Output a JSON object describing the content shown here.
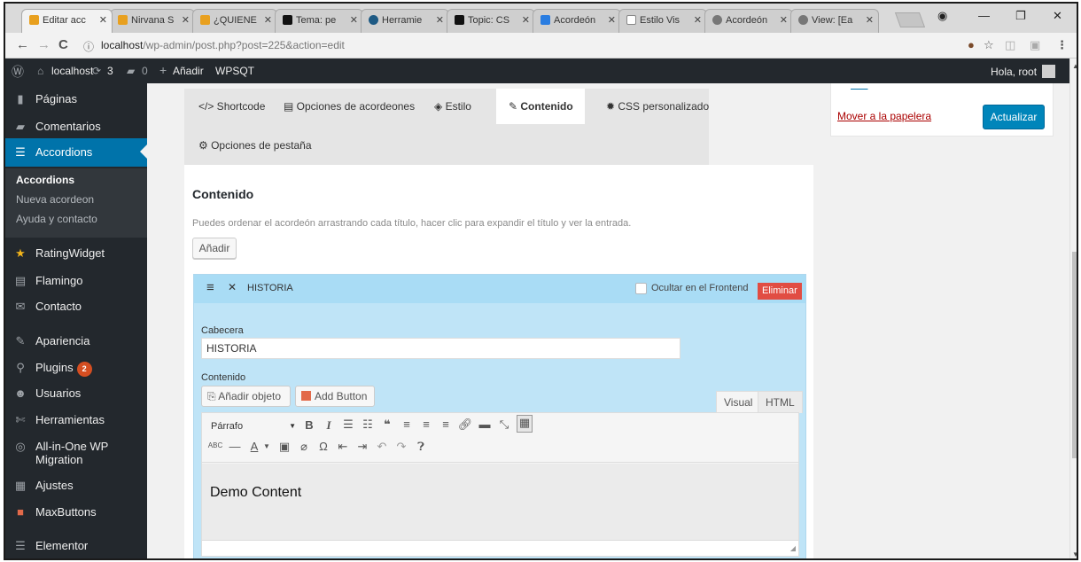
{
  "browser": {
    "tabs": [
      {
        "title": "Editar acc",
        "favicon_color": "#e8a01f"
      },
      {
        "title": "Nirvana S",
        "favicon_color": "#e8a01f"
      },
      {
        "title": "¿QUIENE",
        "favicon_color": "#e8a01f"
      },
      {
        "title": "Tema: pe",
        "favicon_color": "#111111"
      },
      {
        "title": "Herramie",
        "favicon_color": "#1e5a84"
      },
      {
        "title": "Topic: CS",
        "favicon_color": "#111111"
      },
      {
        "title": "Acordeón",
        "favicon_color": "#2a7de1"
      },
      {
        "title": "Estilo Vis",
        "favicon_color": "#888888"
      },
      {
        "title": "Acordeón",
        "favicon_color": "#777777"
      },
      {
        "title": "View: [Ea",
        "favicon_color": "#777777"
      }
    ],
    "url_host": "localhost",
    "url_path": "/wp-admin/post.php?post=225&action=edit"
  },
  "adminbar": {
    "site": "localhost",
    "updates": "3",
    "comments": "0",
    "new": "Añadir",
    "plugin": "WPSQT",
    "greeting": "Hola, root"
  },
  "sidebar": {
    "items": [
      {
        "label": "Páginas",
        "icon": "pages-icon"
      },
      {
        "label": "Comentarios",
        "icon": "comments-icon"
      },
      {
        "label": "Accordions",
        "icon": "accordions-icon"
      },
      {
        "label": "RatingWidget",
        "icon": "star-icon"
      },
      {
        "label": "Flamingo",
        "icon": "flamingo-icon"
      },
      {
        "label": "Contacto",
        "icon": "mail-icon"
      },
      {
        "label": "Apariencia",
        "icon": "brush-icon"
      },
      {
        "label": "Plugins",
        "icon": "plugin-icon",
        "badge": "2"
      },
      {
        "label": "Usuarios",
        "icon": "users-icon"
      },
      {
        "label": "Herramientas",
        "icon": "wrench-icon"
      },
      {
        "label": "All-in-One WP Migration",
        "icon": "migration-icon"
      },
      {
        "label": "Ajustes",
        "icon": "settings-icon"
      },
      {
        "label": "MaxButtons",
        "icon": "maxbuttons-icon"
      },
      {
        "label": "Elementor",
        "icon": "elementor-icon"
      }
    ],
    "submenu": [
      "Accordions",
      "Nueva acordeon",
      "Ayuda y contacto"
    ]
  },
  "content_tabs": [
    "</> Shortcode",
    "Opciones de acordeones",
    "Estilo",
    "Contenido",
    "CSS personalizado",
    "Opciones de pestaña"
  ],
  "panel": {
    "title": "Contenido",
    "description": "Puedes ordenar el acordeón arrastrando cada título, hacer clic para expandir el título y ver la entrada.",
    "add_button": "Añadir"
  },
  "accordion_item": {
    "title": "HISTORIA",
    "hide_label": "Ocultar en el Frontend",
    "delete_label": "Eliminar",
    "header_label": "Cabecera",
    "header_value": "HISTORIA",
    "content_label": "Contenido",
    "add_media": "Añadir objeto",
    "add_button": "Add Button",
    "tab_visual": "Visual",
    "tab_html": "HTML",
    "format": "Párrafo",
    "content": "Demo Content"
  },
  "publish": {
    "trash": "Mover a la papelera",
    "update": "Actualizar"
  }
}
